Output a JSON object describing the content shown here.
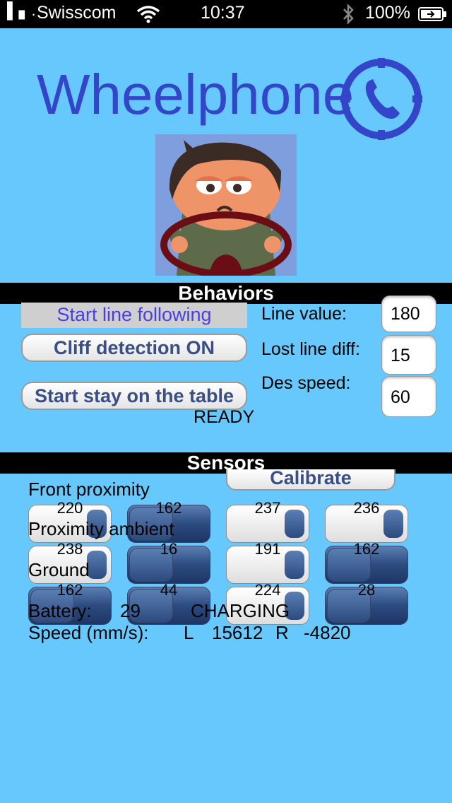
{
  "status_bar": {
    "carrier": "Swisscom",
    "time": "10:37",
    "battery": "100%"
  },
  "app": {
    "title": "Wheelphone"
  },
  "behaviors": {
    "header": "Behaviors",
    "line_following_label": "Start line following",
    "cliff_detection_label": "Cliff detection ON",
    "stay_on_table_label": "Start stay on the table",
    "status": "READY",
    "line_value_label": "Line value:",
    "line_value": "180",
    "lost_line_diff_label": "Lost line diff:",
    "lost_line_diff": "15",
    "des_speed_label": "Des speed:",
    "des_speed": "60"
  },
  "sensors": {
    "header": "Sensors",
    "calibrate_label": "Calibrate",
    "front_proximity_label": "Front proximity",
    "proximity_ambient_label": "Proximity ambient",
    "ground_label": "Ground",
    "battery_label": "Battery:",
    "battery_value": "29",
    "charging_status": "CHARGING",
    "speed_label": "Speed (mm/s):",
    "speed_left_label": "L",
    "speed_left": "15612",
    "speed_right_label": "R",
    "speed_right": "-4820",
    "rows": [
      {
        "values": [
          "220",
          "162",
          "237",
          "236"
        ],
        "toggles": [
          true,
          false,
          true,
          true
        ]
      },
      {
        "values": [
          "238",
          "16",
          "191",
          "162"
        ],
        "toggles": [
          true,
          false,
          true,
          false
        ]
      },
      {
        "values": [
          "162",
          "44",
          "224",
          "28"
        ],
        "toggles": [
          false,
          false,
          true,
          false
        ]
      }
    ]
  },
  "colors": {
    "background": "#66c8fc",
    "title": "#3345c8",
    "button_text": "#394f85",
    "link_text": "#4a3fe0"
  }
}
